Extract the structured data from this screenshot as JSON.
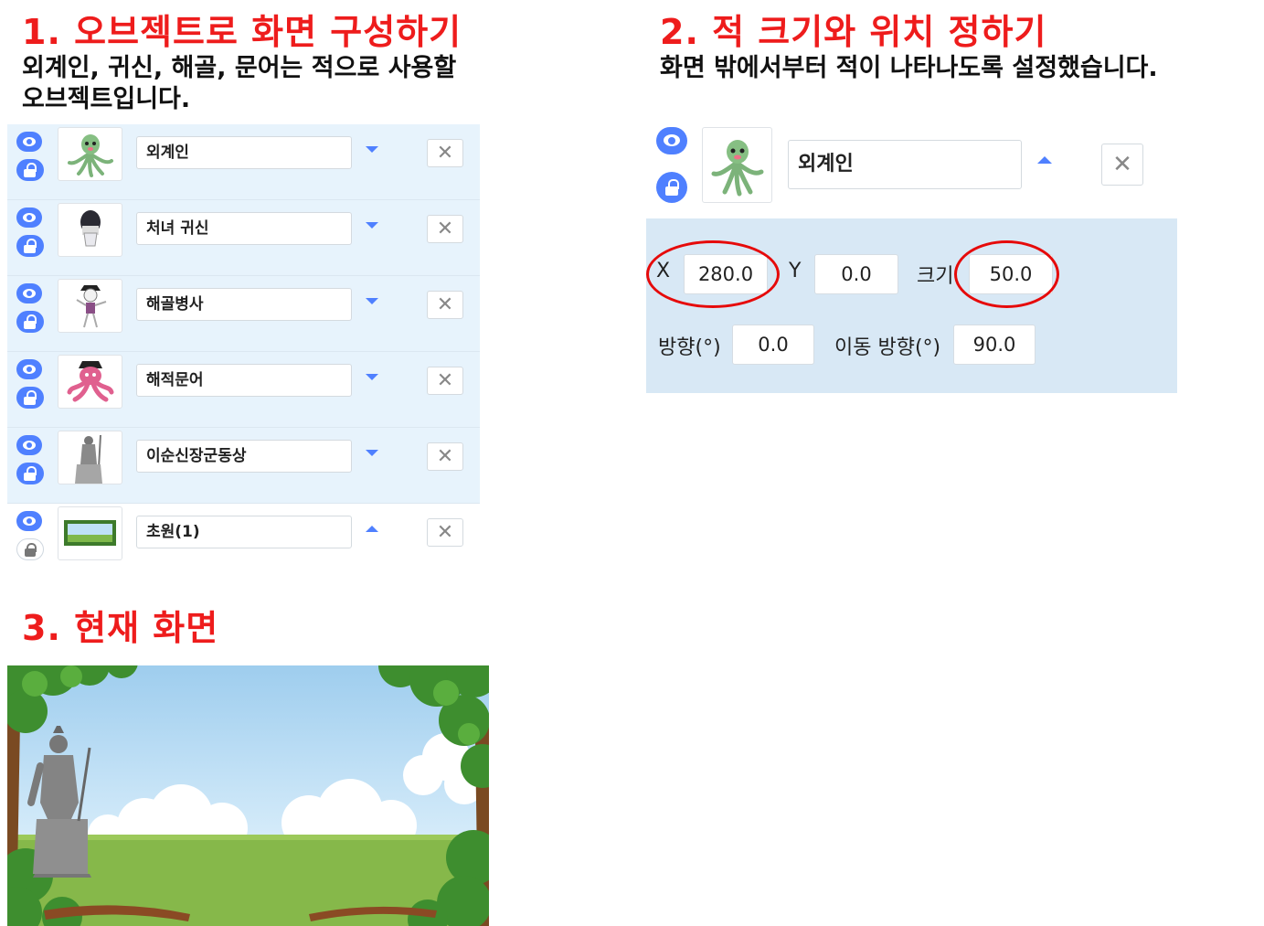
{
  "section1": {
    "title": "1. 오브젝트로 화면 구성하기",
    "description": "외계인, 귀신, 해골, 문어는 적으로 사용할 오브젝트입니다.",
    "objects": [
      {
        "name": "외계인",
        "caret": "down"
      },
      {
        "name": "처녀 귀신",
        "caret": "down"
      },
      {
        "name": "해골병사",
        "caret": "down"
      },
      {
        "name": "해적문어",
        "caret": "down"
      },
      {
        "name": "이순신장군동상",
        "caret": "down"
      },
      {
        "name": "초원(1)",
        "caret": "up"
      }
    ],
    "delete_symbol": "✕"
  },
  "section2": {
    "title": "2. 적 크기와 위치 정하기",
    "description": "화면 밖에서부터 적이 나타나도록 설정했습니다.",
    "object_name": "외계인",
    "delete_symbol": "✕",
    "fields": {
      "x_label": "X",
      "x_value": "280.0",
      "y_label": "Y",
      "y_value": "0.0",
      "size_label": "크기",
      "size_value": "50.0",
      "direction_label": "방향(°)",
      "direction_value": "0.0",
      "move_direction_label": "이동 방향(°)",
      "move_direction_value": "90.0"
    },
    "highlight_color": "#e60a0a"
  },
  "section3": {
    "title": "3. 현재 화면"
  },
  "colors": {
    "heading": "#ee1c1c",
    "accent": "#4f80ff",
    "list_bg": "#e7f3fc",
    "panel_bg": "#d8e8f5"
  }
}
